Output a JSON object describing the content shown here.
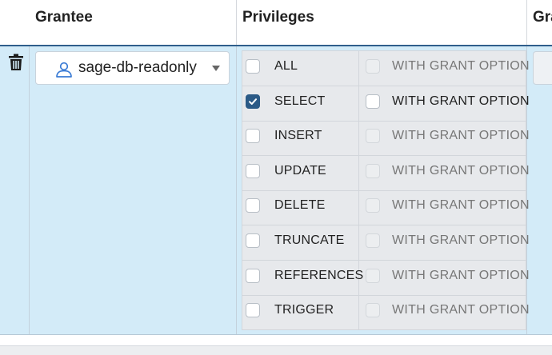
{
  "header": {
    "grantee_label": "Grantee",
    "privileges_label": "Privileges",
    "grantor_label": "Gra"
  },
  "row": {
    "grantee": "sage-db-readonly",
    "privileges": [
      {
        "name": "ALL",
        "checked": false,
        "grant_label": "WITH GRANT OPTION",
        "grant_enabled": false
      },
      {
        "name": "SELECT",
        "checked": true,
        "grant_label": "WITH GRANT OPTION",
        "grant_enabled": true
      },
      {
        "name": "INSERT",
        "checked": false,
        "grant_label": "WITH GRANT OPTION",
        "grant_enabled": false
      },
      {
        "name": "UPDATE",
        "checked": false,
        "grant_label": "WITH GRANT OPTION",
        "grant_enabled": false
      },
      {
        "name": "DELETE",
        "checked": false,
        "grant_label": "WITH GRANT OPTION",
        "grant_enabled": false
      },
      {
        "name": "TRUNCATE",
        "checked": false,
        "grant_label": "WITH GRANT OPTION",
        "grant_enabled": false
      },
      {
        "name": "REFERENCES",
        "checked": false,
        "grant_label": "WITH GRANT OPTION",
        "grant_enabled": false
      },
      {
        "name": "TRIGGER",
        "checked": false,
        "grant_label": "WITH GRANT OPTION",
        "grant_enabled": false
      }
    ]
  },
  "icons": {
    "delete": "trash-icon",
    "user": "user-icon",
    "dropdown": "chevron-down-icon",
    "check": "check-icon"
  },
  "colors": {
    "row_background": "#d3ebf8",
    "header_border": "#2f5e8c",
    "checkbox_checked": "#2b5a86"
  }
}
